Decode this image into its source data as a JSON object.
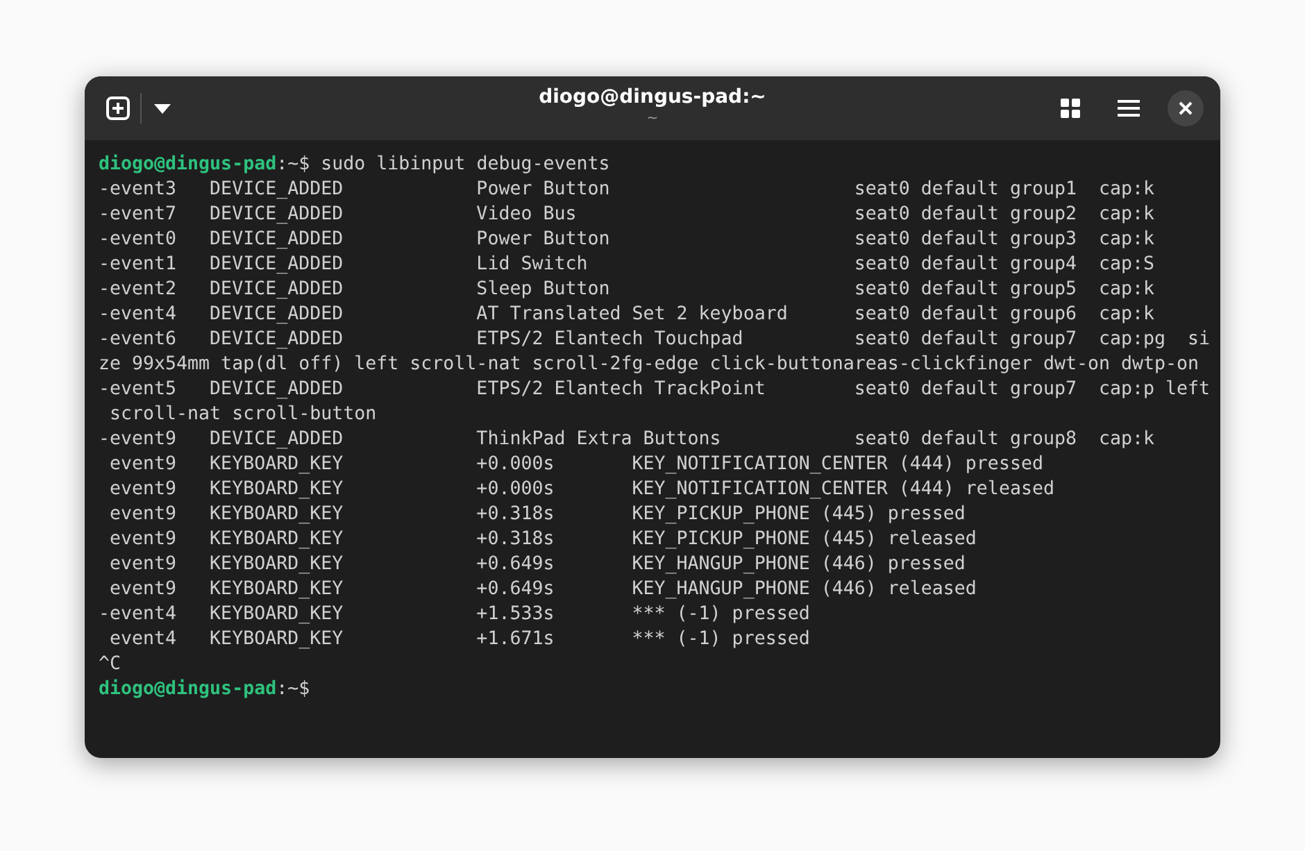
{
  "window": {
    "title": "diogo@dingus-pad:~",
    "subtitle": "~"
  },
  "terminal": {
    "lines": [
      {
        "kind": "prompt",
        "user_host": "diogo@dingus-pad",
        "rest": ":~$ sudo libinput debug-events"
      },
      {
        "kind": "output",
        "text": "-event3   DEVICE_ADDED            Power Button                      seat0 default group1  cap:k"
      },
      {
        "kind": "output",
        "text": "-event7   DEVICE_ADDED            Video Bus                         seat0 default group2  cap:k"
      },
      {
        "kind": "output",
        "text": "-event0   DEVICE_ADDED            Power Button                      seat0 default group3  cap:k"
      },
      {
        "kind": "output",
        "text": "-event1   DEVICE_ADDED            Lid Switch                        seat0 default group4  cap:S"
      },
      {
        "kind": "output",
        "text": "-event2   DEVICE_ADDED            Sleep Button                      seat0 default group5  cap:k"
      },
      {
        "kind": "output",
        "text": "-event4   DEVICE_ADDED            AT Translated Set 2 keyboard      seat0 default group6  cap:k"
      },
      {
        "kind": "output",
        "text": "-event6   DEVICE_ADDED            ETPS/2 Elantech Touchpad          seat0 default group7  cap:pg  si"
      },
      {
        "kind": "output",
        "text": "ze 99x54mm tap(dl off) left scroll-nat scroll-2fg-edge click-buttonareas-clickfinger dwt-on dwtp-on"
      },
      {
        "kind": "output",
        "text": "-event5   DEVICE_ADDED            ETPS/2 Elantech TrackPoint        seat0 default group7  cap:p left"
      },
      {
        "kind": "output",
        "text": " scroll-nat scroll-button"
      },
      {
        "kind": "output",
        "text": "-event9   DEVICE_ADDED            ThinkPad Extra Buttons            seat0 default group8  cap:k"
      },
      {
        "kind": "output",
        "text": " event9   KEYBOARD_KEY            +0.000s       KEY_NOTIFICATION_CENTER (444) pressed"
      },
      {
        "kind": "output",
        "text": " event9   KEYBOARD_KEY            +0.000s       KEY_NOTIFICATION_CENTER (444) released"
      },
      {
        "kind": "output",
        "text": " event9   KEYBOARD_KEY            +0.318s       KEY_PICKUP_PHONE (445) pressed"
      },
      {
        "kind": "output",
        "text": " event9   KEYBOARD_KEY            +0.318s       KEY_PICKUP_PHONE (445) released"
      },
      {
        "kind": "output",
        "text": " event9   KEYBOARD_KEY            +0.649s       KEY_HANGUP_PHONE (446) pressed"
      },
      {
        "kind": "output",
        "text": " event9   KEYBOARD_KEY            +0.649s       KEY_HANGUP_PHONE (446) released"
      },
      {
        "kind": "output",
        "text": "-event4   KEYBOARD_KEY            +1.533s       *** (-1) pressed"
      },
      {
        "kind": "output",
        "text": " event4   KEYBOARD_KEY            +1.671s       *** (-1) pressed"
      },
      {
        "kind": "output",
        "text": "^C"
      },
      {
        "kind": "prompt",
        "user_host": "diogo@dingus-pad",
        "rest": ":~$"
      }
    ]
  }
}
